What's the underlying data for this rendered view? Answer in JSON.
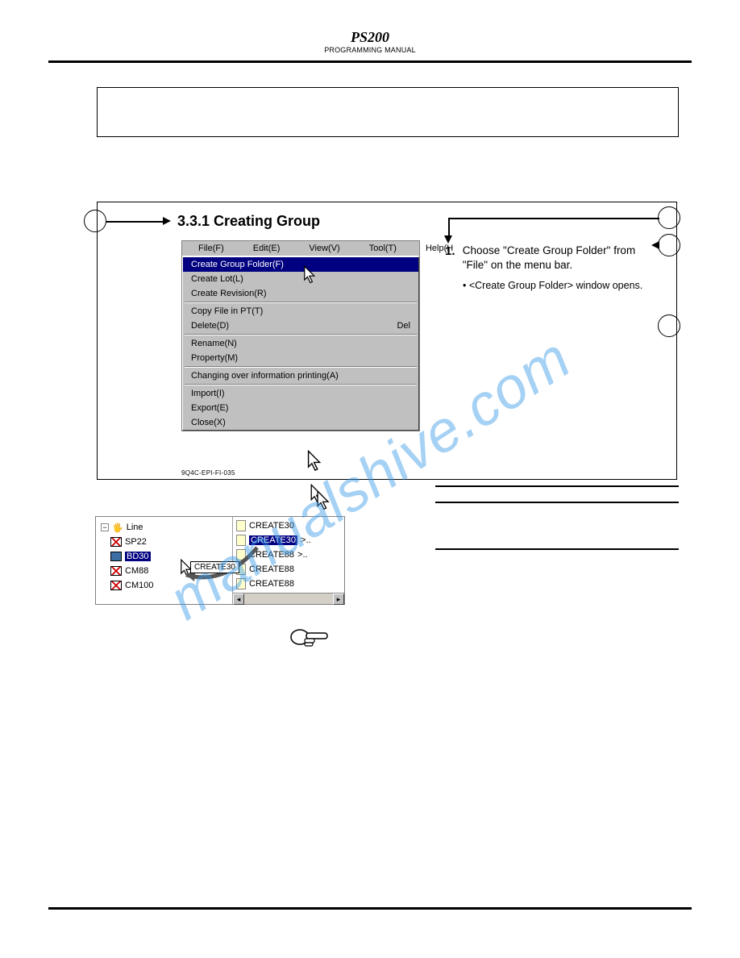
{
  "header": {
    "model": "PS200",
    "sub": "PROGRAMMING MANUAL"
  },
  "section": {
    "heading": "3.3.1 Creating Group",
    "figref": "9Q4C-EPI-FI-035"
  },
  "menubar": {
    "file": "File(F)",
    "edit": "Edit(E)",
    "view": "View(V)",
    "tool": "Tool(T)",
    "help": "Help(H"
  },
  "menu": {
    "items": [
      {
        "label": "Create Group Folder(F)",
        "shortcut": "",
        "selected": true
      },
      {
        "label": "Create Lot(L)",
        "shortcut": ""
      },
      {
        "label": "Create Revision(R)",
        "shortcut": ""
      }
    ],
    "group2": [
      {
        "label": "Copy File in PT(T)",
        "shortcut": ""
      },
      {
        "label": "Delete(D)",
        "shortcut": "Del"
      }
    ],
    "group3": [
      {
        "label": "Rename(N)",
        "shortcut": ""
      },
      {
        "label": "Property(M)",
        "shortcut": ""
      }
    ],
    "group4": [
      {
        "label": "Changing over information printing(A)",
        "shortcut": ""
      }
    ],
    "group5": [
      {
        "label": "Import(I)",
        "shortcut": ""
      },
      {
        "label": "Export(E)",
        "shortcut": ""
      },
      {
        "label": "Close(X)",
        "shortcut": ""
      }
    ]
  },
  "step": {
    "num": "1.",
    "text": "Choose \"Create Group Folder\" from \"File\" on the menu bar.",
    "bullet": "<Create Group Folder> window opens."
  },
  "tree": {
    "root": "Line",
    "items": [
      "SP22",
      "BD30",
      "CM88",
      "CM100"
    ],
    "drag_tip": "CREATE30",
    "list": [
      "CREATE30",
      "CREATE30",
      "CREATE88",
      "CREATE88",
      "CREATE88"
    ]
  },
  "watermark": "manualshive.com"
}
